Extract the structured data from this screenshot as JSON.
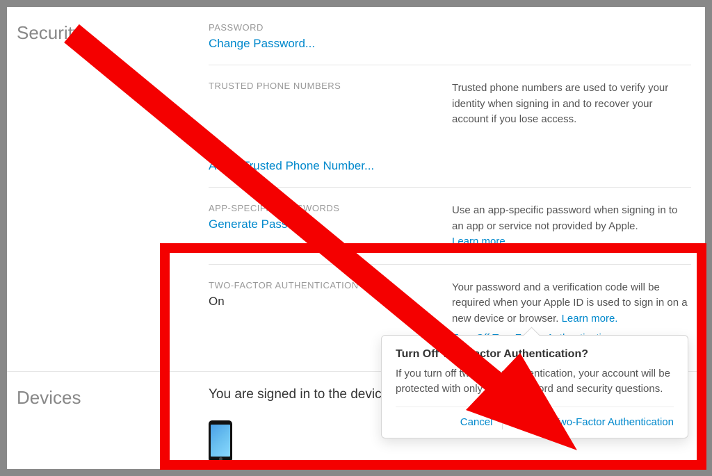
{
  "sections": {
    "security": {
      "title": "Security",
      "password": {
        "label": "PASSWORD",
        "change_link": "Change Password..."
      },
      "trusted_phone": {
        "label": "TRUSTED PHONE NUMBERS",
        "desc": "Trusted phone numbers are used to verify your identity when signing in and to recover your account if you lose access.",
        "add_link": "Add a Trusted Phone Number..."
      },
      "app_specific": {
        "label": "APP-SPECIFIC PASSWORDS",
        "generate_link": "Generate Password...",
        "desc": "Use an app-specific password when signing in to an app or service not provided by Apple.",
        "learn_more": "Learn more."
      },
      "two_factor": {
        "label": "TWO-FACTOR AUTHENTICATION",
        "value": "On",
        "desc_part1": "Your password and a verification code will be required when your Apple ID is used to sign in on a new device or browser. ",
        "learn_more": "Learn more.",
        "turn_off_link": "Turn Off Two-Factor Authentication"
      }
    },
    "devices": {
      "title": "Devices",
      "signed_in_text": "You are signed in to the devices below with ..."
    }
  },
  "popover": {
    "title": "Turn Off Two-Factor Authentication?",
    "body": "If you turn off two-factor authentication, your account will be protected with only your password and security questions.",
    "cancel": "Cancel",
    "confirm": "Turn Off Two-Factor Authentication"
  },
  "colors": {
    "link": "#0088cc",
    "annotation": "#f40000"
  }
}
